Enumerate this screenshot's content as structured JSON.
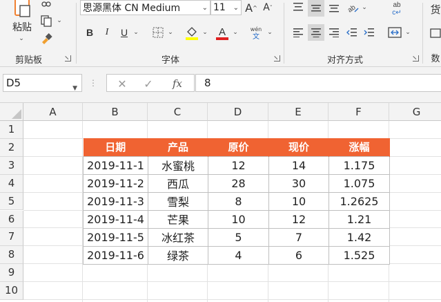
{
  "ribbon": {
    "clipboard": {
      "paste_label": "粘贴",
      "group_label": "剪贴板"
    },
    "font": {
      "font_name": "思源黑体 CN Medium",
      "font_size": "11",
      "group_label": "字体"
    },
    "alignment": {
      "group_label": "对齐方式"
    },
    "right_cut": {
      "top_char": "货",
      "bottom_char": "数"
    }
  },
  "formula_bar": {
    "name_box": "D5",
    "formula": "8"
  },
  "sheet": {
    "columns": [
      "A",
      "B",
      "C",
      "D",
      "E",
      "F",
      "G"
    ],
    "rows": [
      "1",
      "2",
      "3",
      "4",
      "5",
      "6",
      "7",
      "8",
      "9",
      "10"
    ]
  },
  "table": {
    "headers": [
      "日期",
      "产品",
      "原价",
      "现价",
      "涨幅"
    ],
    "rows": [
      [
        "2019-11-1",
        "水蜜桃",
        "12",
        "14",
        "1.175"
      ],
      [
        "2019-11-2",
        "西瓜",
        "28",
        "30",
        "1.075"
      ],
      [
        "2019-11-3",
        "雪梨",
        "8",
        "10",
        "1.2625"
      ],
      [
        "2019-11-4",
        "芒果",
        "10",
        "12",
        "1.21"
      ],
      [
        "2019-11-5",
        "冰红茶",
        "5",
        "7",
        "1.42"
      ],
      [
        "2019-11-6",
        "绿茶",
        "4",
        "6",
        "1.525"
      ]
    ]
  },
  "colors": {
    "header_fill": "#f06332",
    "highlight_yellow": "#ffff00",
    "font_red": "#e02020"
  },
  "icons": [
    "paste-icon",
    "copy-icon",
    "format-painter-icon",
    "bold-icon",
    "italic-icon",
    "underline-icon",
    "border-icon",
    "fill-color-icon",
    "font-color-icon",
    "phonetic-icon",
    "align-icons",
    "wrap-text-icon",
    "merge-icon",
    "cancel-icon",
    "enter-icon",
    "fx-icon"
  ]
}
